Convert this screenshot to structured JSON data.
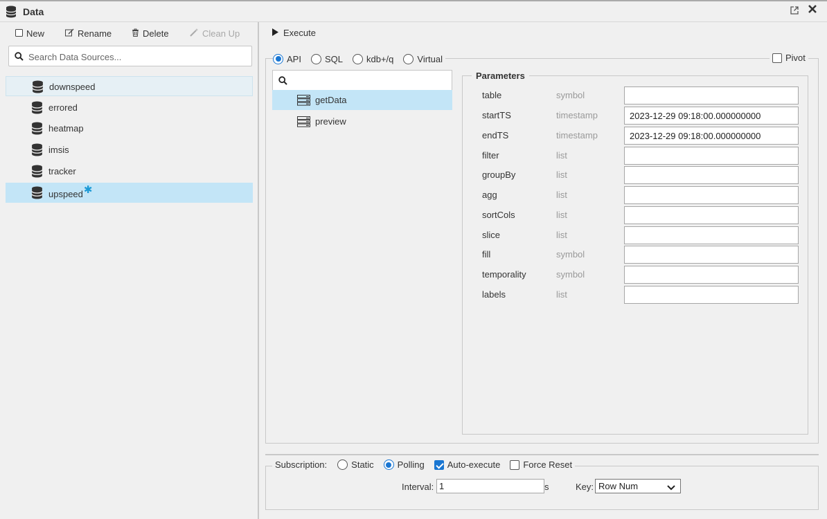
{
  "window": {
    "title": "Data",
    "icons": {
      "app": "database-icon",
      "popout": "popout-icon",
      "close": "close-icon"
    }
  },
  "left_panel": {
    "toolbar": {
      "new_label": "New",
      "rename_label": "Rename",
      "delete_label": "Delete",
      "cleanup_label": "Clean Up"
    },
    "search": {
      "placeholder": "Search Data Sources..."
    },
    "data_sources": [
      {
        "label": "downspeed",
        "state": "hover"
      },
      {
        "label": "errored",
        "state": "normal"
      },
      {
        "label": "heatmap",
        "state": "normal"
      },
      {
        "label": "imsis",
        "state": "normal"
      },
      {
        "label": "tracker",
        "state": "normal"
      },
      {
        "label": "upspeed",
        "state": "selected",
        "modified": true,
        "modified_marker": "✱"
      }
    ]
  },
  "right_panel": {
    "execute_label": "Execute",
    "modes": [
      {
        "label": "API",
        "checked": true
      },
      {
        "label": "SQL",
        "checked": false
      },
      {
        "label": "kdb+/q",
        "checked": false
      },
      {
        "label": "Virtual",
        "checked": false
      }
    ],
    "pivot": {
      "label": "Pivot",
      "checked": false
    },
    "api_search": {
      "value": ""
    },
    "api_list": [
      {
        "label": "getData",
        "selected": true
      },
      {
        "label": "preview",
        "selected": false
      }
    ],
    "parameters": {
      "title": "Parameters",
      "rows": [
        {
          "name": "table",
          "type": "symbol",
          "value": ""
        },
        {
          "name": "startTS",
          "type": "timestamp",
          "value": "2023-12-29 09:18:00.000000000"
        },
        {
          "name": "endTS",
          "type": "timestamp",
          "value": "2023-12-29 09:18:00.000000000"
        },
        {
          "name": "filter",
          "type": "list",
          "value": ""
        },
        {
          "name": "groupBy",
          "type": "list",
          "value": ""
        },
        {
          "name": "agg",
          "type": "list",
          "value": ""
        },
        {
          "name": "sortCols",
          "type": "list",
          "value": ""
        },
        {
          "name": "slice",
          "type": "list",
          "value": ""
        },
        {
          "name": "fill",
          "type": "symbol",
          "value": ""
        },
        {
          "name": "temporality",
          "type": "symbol",
          "value": ""
        },
        {
          "name": "labels",
          "type": "list",
          "value": ""
        }
      ]
    },
    "subscription": {
      "label": "Subscription:",
      "static_label": "Static",
      "static_checked": false,
      "polling_label": "Polling",
      "polling_checked": true,
      "auto_execute_label": "Auto-execute",
      "auto_execute_checked": true,
      "force_reset_label": "Force Reset",
      "force_reset_checked": false,
      "interval_label": "Interval:",
      "interval_value": "1",
      "interval_unit": "s",
      "key_label": "Key:",
      "key_value": "Row Num"
    }
  },
  "colors": {
    "selection": "#c3e5f7",
    "hover": "#e6f0f5",
    "accent": "#1976d2",
    "modified_star": "#1c9ad6"
  }
}
